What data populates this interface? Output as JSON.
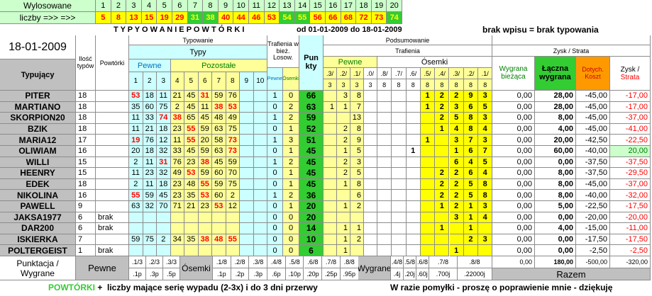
{
  "draw": {
    "label": "Wylosowane",
    "positions": [
      "1",
      "2",
      "3",
      "4",
      "5",
      "6",
      "7",
      "8",
      "9",
      "10",
      "11",
      "12",
      "13",
      "14",
      "15",
      "16",
      "17",
      "18",
      "19",
      "20"
    ],
    "numbers_label": "liczby =>> =>>",
    "numbers": [
      "5",
      "8",
      "13",
      "15",
      "19",
      "29",
      "31",
      "38",
      "40",
      "44",
      "46",
      "53",
      "54",
      "55",
      "56",
      "66",
      "68",
      "72",
      "73",
      "74"
    ]
  },
  "banner": {
    "title": "T Y P Y O W A N I E   P O W T Ó R K I",
    "period": "od   01-01-2009  do  18-01-2009",
    "note": "brak wpisu = brak typowania"
  },
  "header": {
    "date": "18-01-2009",
    "player_col": "Typujący",
    "count_col": "Ilość typów",
    "repeats_col": "Powtórki",
    "typing_group": "Typowanie",
    "types_group": "Typy",
    "sure_label": "Pewne",
    "other_label": "Pozostałe",
    "type_positions": [
      "1",
      "2",
      "3",
      "4",
      "5",
      "6",
      "7",
      "8",
      "9",
      "10"
    ],
    "hits_group": "Trafienia w bież. Losow.",
    "hits_sure": "Pewne",
    "hits_eight": "Ósemki",
    "points_col": "Pun kty",
    "summary_group": "Podsumowanie",
    "summary_hits": "Trafienia",
    "sure_sub": "Pewne",
    "eight_sub": "Ósemki",
    "sure_cols": [
      {
        "a": ".3/",
        "b": "3"
      },
      {
        "a": ".2/",
        "b": "3"
      },
      {
        "a": ".1/",
        "b": "3"
      },
      {
        "a": ".0/",
        "b": "3"
      }
    ],
    "eight_cols": [
      {
        "a": ".8/",
        "b": "8"
      },
      {
        "a": ".7/",
        "b": "8"
      },
      {
        "a": ".6/",
        "b": "8"
      },
      {
        "a": ".5/",
        "b": "8"
      },
      {
        "a": ".4/",
        "b": "8"
      },
      {
        "a": ".3/",
        "b": "8"
      },
      {
        "a": ".2/",
        "b": "8"
      },
      {
        "a": ".1/",
        "b": "8"
      }
    ],
    "profit_group": "Zysk / Strata",
    "current_win": "Wygrana bieżąca",
    "total_win": "Łączna wygrana",
    "cost": "Dotych. Koszt",
    "profit_a": "Zysk /",
    "profit_b": "Strata"
  },
  "players": [
    {
      "name": "PITER",
      "count": "18",
      "rep": "",
      "types": [
        "53",
        "18",
        "11",
        "21",
        "45",
        "31",
        "59",
        "76",
        "",
        ""
      ],
      "red": [
        0,
        5
      ],
      "h1": "1",
      "h2": "0",
      "pts": "66",
      "s": [
        "",
        "3",
        "8",
        ""
      ],
      "e": [
        "",
        "",
        "",
        "1",
        "2",
        "2",
        "9",
        "3"
      ],
      "cur": "0,00",
      "tot": "28,00",
      "cost": "-45,00",
      "prof": "-17,00"
    },
    {
      "name": "MARTIANO",
      "count": "18",
      "rep": "",
      "types": [
        "35",
        "60",
        "75",
        "2",
        "45",
        "11",
        "38",
        "53",
        "",
        ""
      ],
      "red": [
        6,
        7
      ],
      "h1": "0",
      "h2": "2",
      "pts": "63",
      "s": [
        "1",
        "1",
        "7",
        ""
      ],
      "e": [
        "",
        "",
        "",
        "1",
        "2",
        "3",
        "6",
        "5"
      ],
      "cur": "0,00",
      "tot": "28,00",
      "cost": "-45,00",
      "prof": "-17,00"
    },
    {
      "name": "SKORPION20",
      "count": "18",
      "rep": "",
      "types": [
        "11",
        "33",
        "74",
        "38",
        "65",
        "45",
        "48",
        "49",
        "",
        ""
      ],
      "red": [
        2,
        3
      ],
      "h1": "1",
      "h2": "2",
      "pts": "59",
      "s": [
        "",
        "",
        "13",
        ""
      ],
      "e": [
        "",
        "",
        "",
        "",
        "2",
        "5",
        "8",
        "3"
      ],
      "cur": "0,00",
      "tot": "8,00",
      "cost": "-45,00",
      "prof": "-37,00"
    },
    {
      "name": "BZIK",
      "count": "18",
      "rep": "",
      "types": [
        "11",
        "21",
        "18",
        "23",
        "55",
        "59",
        "63",
        "75",
        "",
        ""
      ],
      "red": [
        4
      ],
      "h1": "0",
      "h2": "1",
      "pts": "52",
      "s": [
        "",
        "2",
        "8",
        ""
      ],
      "e": [
        "",
        "",
        "",
        "",
        "1",
        "4",
        "8",
        "4"
      ],
      "cur": "0,00",
      "tot": "4,00",
      "cost": "-45,00",
      "prof": "-41,00"
    },
    {
      "name": "MARIA12",
      "count": "17",
      "rep": "",
      "types": [
        "19",
        "76",
        "12",
        "11",
        "55",
        "20",
        "58",
        "73",
        "",
        ""
      ],
      "red": [
        0,
        4,
        7
      ],
      "h1": "1",
      "h2": "3",
      "pts": "51",
      "s": [
        "",
        "2",
        "9",
        ""
      ],
      "e": [
        "",
        "",
        "",
        "1",
        "",
        "3",
        "7",
        "3"
      ],
      "cur": "0,00",
      "tot": "20,00",
      "cost": "-42,50",
      "prof": "-22,50"
    },
    {
      "name": "OLIWIAM",
      "count": "16",
      "rep": "",
      "types": [
        "20",
        "18",
        "32",
        "33",
        "45",
        "59",
        "63",
        "73",
        "",
        ""
      ],
      "red": [
        7
      ],
      "h1": "0",
      "h2": "1",
      "pts": "45",
      "s": [
        "",
        "1",
        "5",
        ""
      ],
      "e": [
        "",
        "",
        "1",
        "",
        "",
        "1",
        "6",
        "7"
      ],
      "cur": "0,00",
      "tot": "60,00",
      "cost": "-40,00",
      "prof": "20,00"
    },
    {
      "name": "WILLI",
      "count": "15",
      "rep": "",
      "types": [
        "2",
        "11",
        "31",
        "76",
        "23",
        "38",
        "45",
        "59",
        "",
        ""
      ],
      "red": [
        2,
        5
      ],
      "h1": "1",
      "h2": "2",
      "pts": "45",
      "s": [
        "",
        "2",
        "3",
        ""
      ],
      "e": [
        "",
        "",
        "",
        "",
        "",
        "6",
        "4",
        "5"
      ],
      "cur": "0,00",
      "tot": "0,00",
      "cost": "-37,50",
      "prof": "-37,50"
    },
    {
      "name": "HEENRY",
      "count": "15",
      "rep": "",
      "types": [
        "11",
        "23",
        "32",
        "49",
        "53",
        "59",
        "60",
        "70",
        "",
        ""
      ],
      "red": [
        4
      ],
      "h1": "0",
      "h2": "1",
      "pts": "45",
      "s": [
        "",
        "2",
        "5",
        ""
      ],
      "e": [
        "",
        "",
        "",
        "",
        "2",
        "2",
        "6",
        "4"
      ],
      "cur": "0,00",
      "tot": "8,00",
      "cost": "-37,50",
      "prof": "-29,50"
    },
    {
      "name": "EDEK",
      "count": "18",
      "rep": "",
      "types": [
        "2",
        "11",
        "18",
        "23",
        "48",
        "55",
        "59",
        "75",
        "",
        ""
      ],
      "red": [
        5
      ],
      "h1": "0",
      "h2": "1",
      "pts": "45",
      "s": [
        "",
        "1",
        "8",
        ""
      ],
      "e": [
        "",
        "",
        "",
        "",
        "2",
        "2",
        "5",
        "8"
      ],
      "cur": "0,00",
      "tot": "8,00",
      "cost": "-45,00",
      "prof": "-37,00"
    },
    {
      "name": "NIKOLINA",
      "count": "16",
      "rep": "",
      "types": [
        "55",
        "59",
        "45",
        "23",
        "35",
        "53",
        "60",
        "2",
        "",
        ""
      ],
      "red": [
        0,
        5
      ],
      "h1": "1",
      "h2": "2",
      "pts": "36",
      "s": [
        "",
        "",
        "6",
        ""
      ],
      "e": [
        "",
        "",
        "",
        "",
        "2",
        "2",
        "5",
        "8"
      ],
      "cur": "0,00",
      "tot": "8,00",
      "cost": "-40,00",
      "prof": "-32,00"
    },
    {
      "name": "PAWELL",
      "count": "9",
      "rep": "",
      "types": [
        "63",
        "32",
        "70",
        "71",
        "21",
        "23",
        "53",
        "12",
        "",
        ""
      ],
      "red": [
        6
      ],
      "h1": "0",
      "h2": "1",
      "pts": "20",
      "s": [
        "",
        "1",
        "2",
        ""
      ],
      "e": [
        "",
        "",
        "",
        "",
        "1",
        "2",
        "1",
        "3"
      ],
      "cur": "0,00",
      "tot": "5,00",
      "cost": "-22,50",
      "prof": "-17,50"
    },
    {
      "name": "JAKSA1977",
      "count": "6",
      "rep": "brak",
      "types": [
        "",
        "",
        "",
        "",
        "",
        "",
        "",
        "",
        "",
        ""
      ],
      "red": [],
      "h1": "0",
      "h2": "0",
      "pts": "20",
      "s": [
        "",
        "",
        "",
        ""
      ],
      "e": [
        "",
        "",
        "",
        "",
        "",
        "3",
        "1",
        "4"
      ],
      "cur": "0,00",
      "tot": "0,00",
      "cost": "-20,00",
      "prof": "-20,00"
    },
    {
      "name": "DAR200",
      "count": "6",
      "rep": "brak",
      "types": [
        "",
        "",
        "",
        "",
        "",
        "",
        "",
        "",
        "",
        ""
      ],
      "red": [],
      "h1": "0",
      "h2": "0",
      "pts": "14",
      "s": [
        "",
        "1",
        "1",
        ""
      ],
      "e": [
        "",
        "",
        "",
        "",
        "1",
        "",
        "1",
        ""
      ],
      "cur": "0,00",
      "tot": "4,00",
      "cost": "-15,00",
      "prof": "-11,00"
    },
    {
      "name": "ISKIERKA",
      "count": "7",
      "rep": "",
      "types": [
        "59",
        "75",
        "2",
        "34",
        "35",
        "38",
        "48",
        "55",
        "",
        ""
      ],
      "red": [
        5,
        6,
        7
      ],
      "h1": "0",
      "h2": "0",
      "pts": "10",
      "s": [
        "",
        "1",
        "2",
        ""
      ],
      "e": [
        "",
        "",
        "",
        "",
        "",
        "",
        "2",
        "3"
      ],
      "cur": "0,00",
      "tot": "0,00",
      "cost": "-17,50",
      "prof": "-17,50"
    },
    {
      "name": "POLTERGEIST",
      "count": "1",
      "rep": "brak",
      "types": [
        "",
        "",
        "",
        "",
        "",
        "",
        "",
        "",
        "",
        ""
      ],
      "red": [],
      "h1": "0",
      "h2": "0",
      "pts": "6",
      "s": [
        "",
        "1",
        "",
        ""
      ],
      "e": [
        "",
        "",
        "",
        "",
        "",
        "1",
        "",
        ""
      ],
      "cur": "0,00",
      "tot": "0,00",
      "cost": "-2,50",
      "prof": "-2,50"
    }
  ],
  "footer": {
    "label1": "Punktacja /",
    "label2": "Wygrane",
    "sure": "Pewne",
    "sure_cells": [
      ".1/3",
      ".2/3",
      ".3/3"
    ],
    "sure_pay": [
      ".1p",
      ".3p",
      ".5p"
    ],
    "eight": "Ósemki",
    "eight_cells": [
      ".1/8",
      ".2/8",
      ".3/8",
      ".4/8",
      ".5/8",
      ".6/8",
      ".7/8",
      ".8/8"
    ],
    "eight_pay": [
      ".1p",
      ".2p",
      ".3p",
      ".6p",
      ".10p",
      ".20p",
      ".25p",
      ".95p"
    ],
    "wins": "Wygrane",
    "win_cells": [
      ".4/8",
      ".5/8",
      ".6/8",
      ".7/8",
      ".8/8"
    ],
    "win_pay": [
      ".4j",
      ".20j",
      ".60j",
      ".700j",
      ".22000j"
    ],
    "cur": "0,00",
    "tot": "180,00",
    "cost": "-500,00",
    "prof": "-320,00",
    "total": "Razem"
  },
  "note_left_a": "POWTÓRKI",
  "note_left_b": " +  liczby mające serię wypadu (2-3x) i do 3 dni przerwy",
  "note_right": "W razie pomyłki - proszę o poprawienie mnie - dziękuję",
  "colors": {
    "yellow": "#ffff00",
    "green": "#33cc33",
    "cyan": "#ccffff",
    "lightyellow": "#ffff99",
    "gray": "#c0c0c0",
    "red": "#ff0000",
    "orange": "#ff9900",
    "lightgreen": "#ccffcc"
  }
}
